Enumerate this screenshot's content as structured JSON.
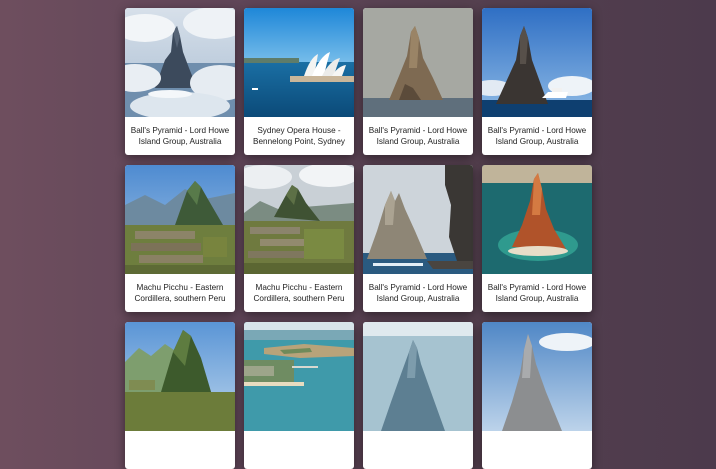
{
  "gallery": {
    "cards": [
      {
        "caption": "Ball's Pyramid - Lord Howe Island Group, Australia",
        "image": "pyramid-in-clouds"
      },
      {
        "caption": "Sydney Opera House - Bennelong Point, Sydney",
        "image": "sydney-opera-house"
      },
      {
        "caption": "Ball's Pyramid - Lord Howe Island Group, Australia",
        "image": "pyramid-grey-sea"
      },
      {
        "caption": "Ball's Pyramid - Lord Howe Island Group, Australia",
        "image": "pyramid-with-boat"
      },
      {
        "caption": "Machu Picchu - Eastern Cordillera, southern Peru",
        "image": "machu-picchu-ruins"
      },
      {
        "caption": "Machu Picchu - Eastern Cordillera, southern Peru",
        "image": "machu-picchu-clouds"
      },
      {
        "caption": "Ball's Pyramid - Lord Howe Island Group, Australia",
        "image": "pyramid-cliffs"
      },
      {
        "caption": "Ball's Pyramid - Lord Howe Island Group, Australia",
        "image": "pyramid-aerial-reef"
      },
      {
        "caption": "",
        "image": "machu-picchu-peak"
      },
      {
        "caption": "",
        "image": "coastal-town-aerial"
      },
      {
        "caption": "",
        "image": "pyramid-haze"
      },
      {
        "caption": "",
        "image": "pyramid-sky"
      }
    ]
  }
}
